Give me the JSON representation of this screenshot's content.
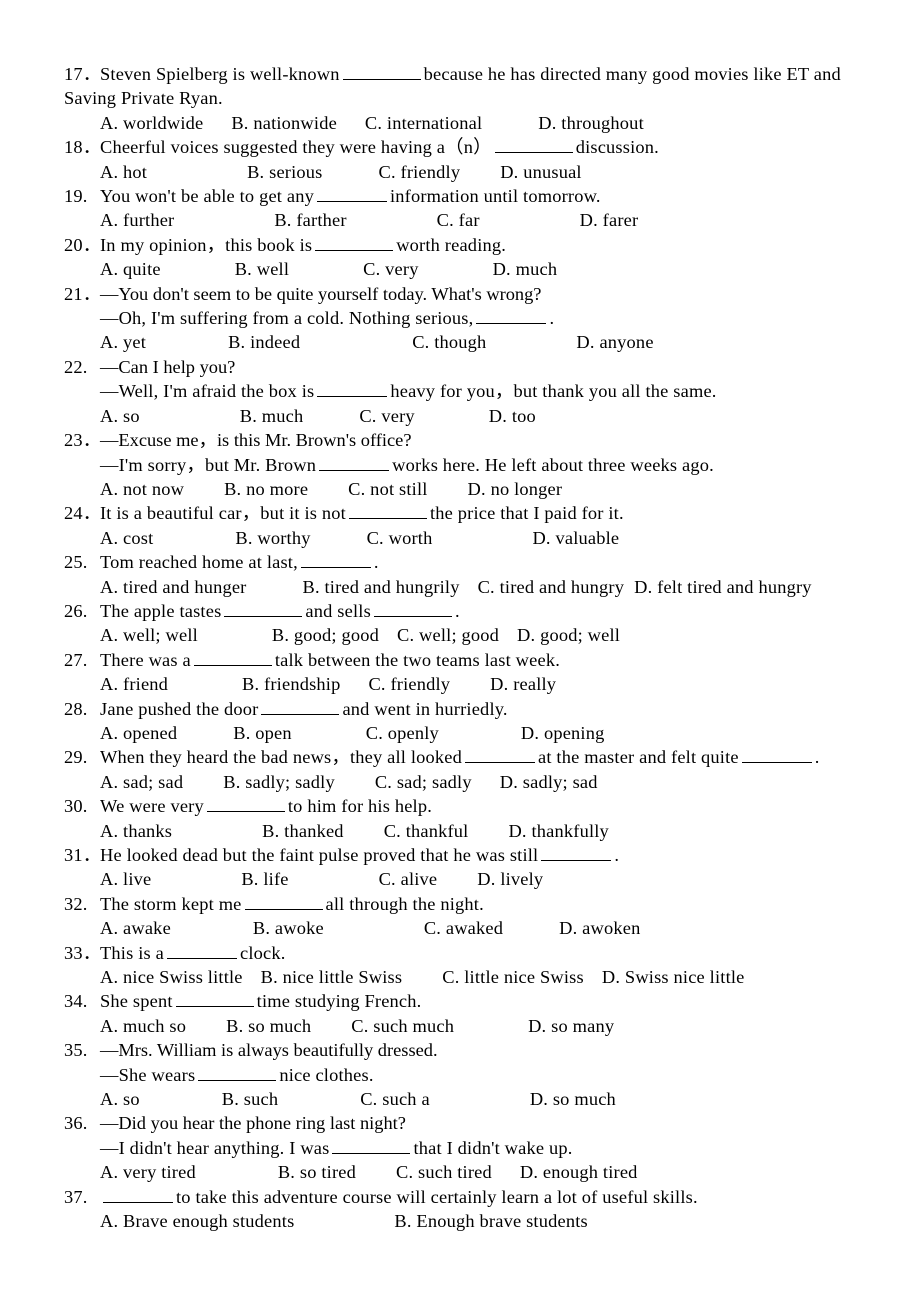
{
  "document": {
    "type": "english-grammar-multiple-choice-worksheet",
    "page_background": "#ffffff",
    "text_color": "#000000"
  },
  "questions": [
    {
      "number": "17．",
      "stem_part1": "Steven Spielberg is well-known",
      "stem_part2": "because he has directed many good movies like ET and",
      "wrap_line": "Saving Private Ryan.",
      "options": [
        "A. worldwide",
        "B. nationwide",
        "C. international",
        "D. throughout"
      ]
    },
    {
      "number": "18．",
      "stem_part1": "Cheerful voices suggested they were having a（n）",
      "stem_part2": "discussion.",
      "options": [
        "A. hot",
        "B. serious",
        "C. friendly",
        "D. unusual"
      ]
    },
    {
      "number": "19.",
      "stem_part1": "You won't be able to get any",
      "stem_part2": "information until tomorrow.",
      "options": [
        "A. further",
        "B. farther",
        "C. far",
        "D. farer"
      ]
    },
    {
      "number": "20．",
      "stem_part1": "In my opinion，this book is",
      "stem_part2": "worth reading.",
      "options": [
        "A. quite",
        "B. well",
        "C. very",
        "D. much"
      ]
    },
    {
      "number": "21．",
      "dialog_a": "—You don't seem to be quite yourself today. What's wrong?",
      "dialog_b_part1": "—Oh, I'm suffering from a cold. Nothing serious,",
      "dialog_b_part2": ".",
      "options": [
        "A. yet",
        "B. indeed",
        "C. though",
        "D. anyone"
      ]
    },
    {
      "number": "22.",
      "dialog_a": "—Can I help you?",
      "dialog_b_part1": "—Well, I'm afraid the box is",
      "dialog_b_part2": "heavy for you，but thank you all the same.",
      "options": [
        "A. so",
        "B. much",
        "C. very",
        "D. too"
      ]
    },
    {
      "number": "23．",
      "dialog_a": "—Excuse me，is this Mr. Brown's office?",
      "dialog_b_part1": "—I'm sorry，but Mr. Brown",
      "dialog_b_part2": "works here. He left about three weeks ago.",
      "options": [
        "A. not now",
        "B. no more",
        "C. not still",
        "D. no longer"
      ]
    },
    {
      "number": "24．",
      "stem_part1": "It is a beautiful car，but it is not",
      "stem_part2": "the price that I paid for it.",
      "options": [
        "A. cost",
        "B. worthy",
        "C. worth",
        "D. valuable"
      ]
    },
    {
      "number": "25.",
      "stem_part1": "Tom reached home at last,",
      "stem_part2": ".",
      "options": [
        "A. tired and hunger",
        "B. tired and hungrily",
        "C. tired and hungry",
        "D. felt tired and hungry"
      ]
    },
    {
      "number": "26.",
      "stem_part1": "The apple tastes",
      "stem_part2": "and sells",
      "stem_part3": ".",
      "options": [
        "A. well; well",
        "B. good; good",
        "C. well; good",
        "D. good; well"
      ]
    },
    {
      "number": "27.",
      "stem_part1": "There was a",
      "stem_part2": "talk between the two teams last week.",
      "options": [
        "A. friend",
        "B. friendship",
        "C. friendly",
        "D. really"
      ]
    },
    {
      "number": "28.",
      "stem_part1": "Jane pushed the door",
      "stem_part2": "and went in hurriedly.",
      "options": [
        "A. opened",
        "B. open",
        "C. openly",
        "D. opening"
      ]
    },
    {
      "number": "29.",
      "stem_part1": "When they heard the bad news，they all looked",
      "stem_part2": "at the master and felt quite",
      "stem_part3": ".",
      "options": [
        "A. sad; sad",
        "B. sadly; sadly",
        "C. sad; sadly",
        "D. sadly; sad"
      ]
    },
    {
      "number": "30.",
      "stem_part1": "We were very",
      "stem_part2": "to him for his help.",
      "options": [
        "A. thanks",
        "B. thanked",
        "C. thankful",
        "D. thankfully"
      ]
    },
    {
      "number": "31．",
      "stem_part1": "He looked dead but the faint pulse proved that he was still",
      "stem_part2": ".",
      "options": [
        "A. live",
        "B. life",
        "C. alive",
        "D. lively"
      ]
    },
    {
      "number": "32.",
      "stem_part1": "The storm kept me",
      "stem_part2": "all through the night.",
      "options": [
        "A. awake",
        "B. awoke",
        "C. awaked",
        "D. awoken"
      ]
    },
    {
      "number": "33．",
      "stem_part1": "This is a",
      "stem_part2": "clock.",
      "options": [
        "A. nice Swiss little",
        "B. nice little Swiss",
        "C. little nice Swiss",
        "D. Swiss nice little"
      ]
    },
    {
      "number": "34.",
      "stem_part1": "She spent",
      "stem_part2": "time studying French.",
      "options": [
        "A. much so",
        "B. so much",
        "C. such much",
        "D. so many"
      ]
    },
    {
      "number": "35.",
      "dialog_a": "—Mrs. William is always beautifully dressed.",
      "dialog_b_part1": "—She wears",
      "dialog_b_part2": "nice clothes.",
      "options": [
        "A. so",
        "B. such",
        "C. such a",
        "D. so much"
      ]
    },
    {
      "number": "36.",
      "dialog_a": "—Did you hear the phone ring last night?",
      "dialog_b_part1": "—I didn't hear anything. I was",
      "dialog_b_part2": "that I didn't wake up.",
      "options": [
        "A. very tired",
        "B. so tired",
        "C. such tired",
        "D. enough tired"
      ]
    },
    {
      "number": "37.",
      "stem_part1": "",
      "stem_part2": "to take this adventure course will certainly learn a lot of useful skills.",
      "options": [
        "A. Brave enough students",
        "B. Enough brave students"
      ]
    }
  ]
}
